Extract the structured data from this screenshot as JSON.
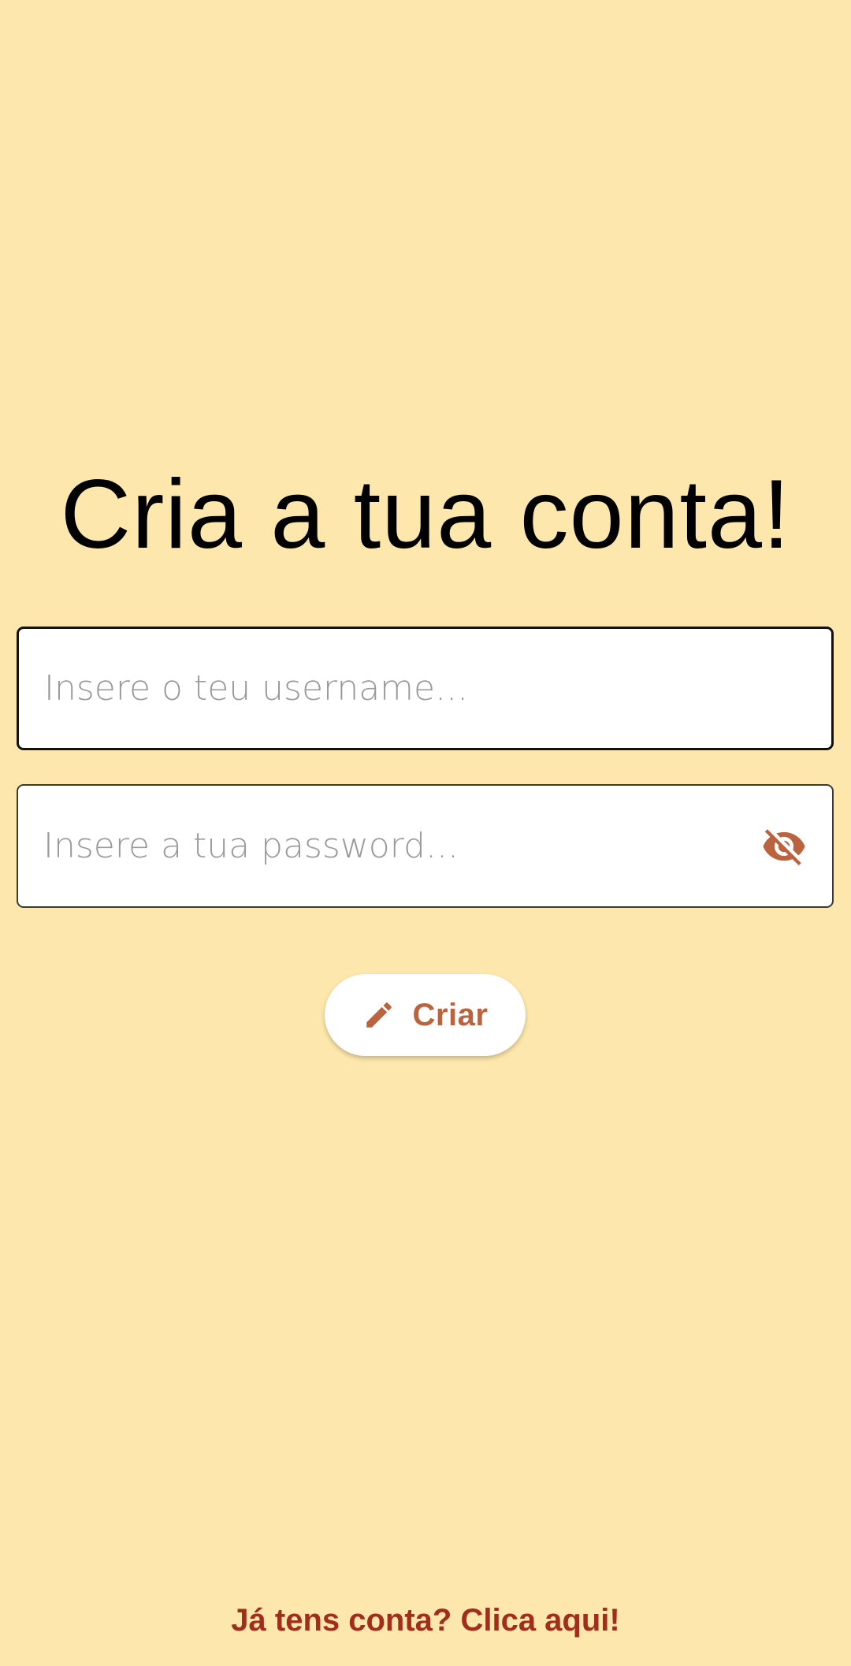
{
  "page": {
    "title": "Cria a tua conta!"
  },
  "form": {
    "username": {
      "placeholder": "Insere o teu username...",
      "value": ""
    },
    "password": {
      "placeholder": "Insere a tua password...",
      "value": "",
      "toggle_icon": "eye-off-icon"
    },
    "submit": {
      "label": "Criar",
      "icon": "pencil-icon"
    }
  },
  "footer": {
    "login_link": "Já tens conta? Clica aqui!"
  },
  "colors": {
    "background": "#fde7ad",
    "accent": "#b9643f",
    "link": "#a02e1b"
  }
}
